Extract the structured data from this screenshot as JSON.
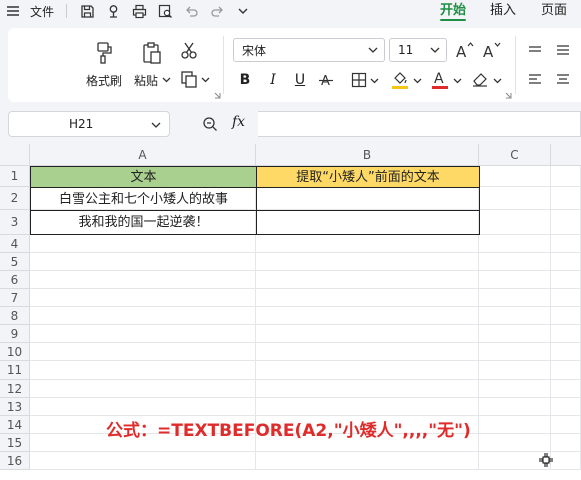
{
  "menubar": {
    "file_label": "文件",
    "tabs": [
      {
        "label": "开始",
        "active": true
      },
      {
        "label": "插入",
        "active": false
      },
      {
        "label": "页面",
        "active": false
      }
    ]
  },
  "ribbon": {
    "format_painter_label": "格式刷",
    "paste_label": "粘贴",
    "font_name": "宋体",
    "font_size": "11",
    "font_color": "#e02b2b",
    "fill_color": "#f5c518"
  },
  "formula_bar": {
    "name_box": "H21",
    "fx_label": "fx",
    "content": ""
  },
  "sheet": {
    "columns": [
      "A",
      "B",
      "C"
    ],
    "rows": [
      "1",
      "2",
      "3",
      "4",
      "5",
      "6",
      "7",
      "8",
      "9",
      "10",
      "11",
      "12",
      "13",
      "14",
      "15",
      "16"
    ],
    "header_row": {
      "a": "文本",
      "b": "提取“小矮人”前面的文本"
    },
    "data_rows": [
      {
        "a": "白雪公主和七个小矮人的故事",
        "b": ""
      },
      {
        "a": "我和我的国一起逆袭！",
        "b": ""
      }
    ],
    "header_a_color": "#a9d08e",
    "header_b_color": "#ffd966"
  },
  "annotation": {
    "text": "公式：=TEXTBEFORE(A2,\"小矮人\",,,,\"无\")",
    "color": "#e02b2b"
  }
}
